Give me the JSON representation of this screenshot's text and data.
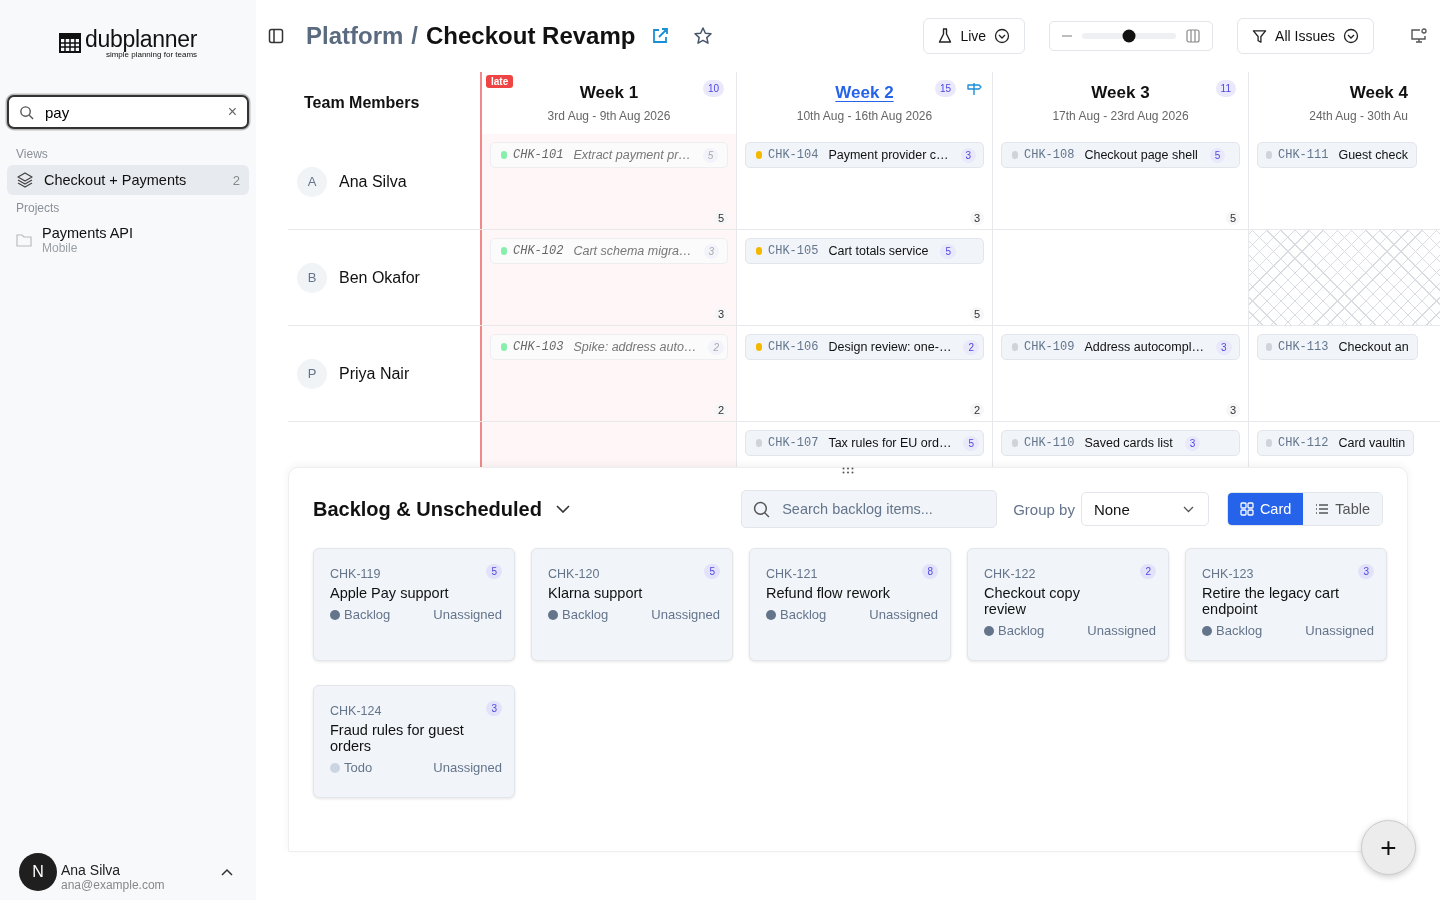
{
  "sidebar": {
    "logo": {
      "name": "dubplanner",
      "tagline": "simple planning for teams"
    },
    "search": {
      "value": "pay",
      "clear": "×"
    },
    "sections": [
      {
        "title": "Views",
        "items": [
          {
            "kind": "view",
            "label": "Checkout + Payments",
            "count": "2",
            "selected": true
          }
        ]
      },
      {
        "title": "Projects",
        "items": [
          {
            "kind": "project",
            "label": "Payments API",
            "sublabel": "Mobile",
            "selected": false
          }
        ]
      }
    ],
    "user": {
      "initial": "N",
      "name": "Ana Silva",
      "email": "ana@example.com"
    }
  },
  "header": {
    "breadcrumb": [
      "Platform",
      "Checkout Revamp"
    ],
    "separator": "/",
    "starred": false,
    "live": {
      "label": "Live"
    },
    "zoom": {
      "level": 0.5
    },
    "filter": {
      "label": "All Issues"
    }
  },
  "board": {
    "team_heading": "Team Members",
    "weeks": [
      {
        "title": "Week 1",
        "dates": "3rd Aug - 9th Aug 2026",
        "count": "10",
        "badge": "late",
        "overdue": true,
        "current": false
      },
      {
        "title": "Week 2",
        "dates": "10th Aug - 16th Aug 2026",
        "count": "15",
        "overdue": false,
        "current": true
      },
      {
        "title": "Week 3",
        "dates": "17th Aug - 23rd Aug 2026",
        "count": "11",
        "overdue": false,
        "current": false
      },
      {
        "title": "Week 4",
        "dates": "24th Aug - 30th Au",
        "overdue": false,
        "current": false
      }
    ],
    "rows": [
      {
        "member": {
          "initial": "A",
          "name": "Ana Silva"
        },
        "cells": [
          {
            "total": "5",
            "tasks": [
              {
                "id": "CHK-101",
                "title": "Extract payment pr…",
                "points": "5",
                "done": true,
                "color": "#86efac"
              }
            ]
          },
          {
            "total": "3",
            "tasks": [
              {
                "id": "CHK-104",
                "title": "Payment provider c…",
                "points": "3",
                "done": false,
                "color": "#f5b800"
              }
            ]
          },
          {
            "total": "5",
            "tasks": [
              {
                "id": "CHK-108",
                "title": "Checkout page shell",
                "points": "5",
                "done": false,
                "color": "#cfd4da"
              }
            ]
          },
          {
            "tasks": [
              {
                "id": "CHK-111",
                "title": "Guest check",
                "done": false,
                "color": "#cfd4da"
              }
            ]
          }
        ]
      },
      {
        "member": {
          "initial": "B",
          "name": "Ben Okafor"
        },
        "cells": [
          {
            "total": "3",
            "tasks": [
              {
                "id": "CHK-102",
                "title": "Cart schema migra…",
                "points": "3",
                "done": true,
                "color": "#86efac"
              }
            ]
          },
          {
            "total": "5",
            "tasks": [
              {
                "id": "CHK-105",
                "title": "Cart totals service",
                "points": "5",
                "done": false,
                "color": "#f5b800"
              }
            ]
          },
          {},
          {
            "blocked": true
          }
        ]
      },
      {
        "member": {
          "initial": "P",
          "name": "Priya Nair"
        },
        "cells": [
          {
            "total": "2",
            "tasks": [
              {
                "id": "CHK-103",
                "title": "Spike: address auto…",
                "points": "2",
                "done": true,
                "color": "#86efac"
              }
            ]
          },
          {
            "total": "2",
            "tasks": [
              {
                "id": "CHK-106",
                "title": "Design review: one-…",
                "points": "2",
                "done": false,
                "color": "#f5b800"
              }
            ]
          },
          {
            "total": "3",
            "tasks": [
              {
                "id": "CHK-109",
                "title": "Address autocompl…",
                "points": "3",
                "done": false,
                "color": "#cfd4da"
              }
            ]
          },
          {
            "tasks": [
              {
                "id": "CHK-113",
                "title": "Checkout an",
                "done": false,
                "color": "#cfd4da"
              }
            ]
          }
        ]
      },
      {
        "cells": [
          {},
          {
            "tasks": [
              {
                "id": "CHK-107",
                "title": "Tax rules for EU ord…",
                "points": "5",
                "done": false,
                "color": "#cfd4da"
              }
            ]
          },
          {
            "tasks": [
              {
                "id": "CHK-110",
                "title": "Saved cards list",
                "points": "3",
                "done": false,
                "color": "#cfd4da"
              }
            ]
          },
          {
            "tasks": [
              {
                "id": "CHK-112",
                "title": "Card vaultin",
                "done": false,
                "color": "#cfd4da"
              }
            ]
          }
        ]
      }
    ]
  },
  "backlog": {
    "title": "Backlog & Unscheduled",
    "search": {
      "placeholder": "Search backlog items..."
    },
    "group_by": {
      "label": "Group by",
      "value": "None"
    },
    "views": [
      {
        "label": "Card",
        "selected": true
      },
      {
        "label": "Table",
        "selected": false
      }
    ],
    "items": [
      {
        "id": "CHK-119",
        "points": "5",
        "title": "Apple Pay support",
        "status": "Backlog",
        "color": "#64748b",
        "assignee": "Unassigned"
      },
      {
        "id": "CHK-120",
        "points": "5",
        "title": "Klarna support",
        "status": "Backlog",
        "color": "#64748b",
        "assignee": "Unassigned"
      },
      {
        "id": "CHK-121",
        "points": "8",
        "title": "Refund flow rework",
        "status": "Backlog",
        "color": "#64748b",
        "assignee": "Unassigned"
      },
      {
        "id": "CHK-122",
        "points": "2",
        "title": "Checkout copy review",
        "status": "Backlog",
        "color": "#64748b",
        "assignee": "Unassigned"
      },
      {
        "id": "CHK-123",
        "points": "3",
        "title": "Retire the legacy cart endpoint",
        "status": "Backlog",
        "color": "#64748b",
        "assignee": "Unassigned"
      },
      {
        "id": "CHK-124",
        "points": "3",
        "title": "Fraud rules for guest orders",
        "status": "Todo",
        "color": "#cbd5e1",
        "assignee": "Unassigned"
      }
    ]
  },
  "fab": {
    "label": "+"
  }
}
